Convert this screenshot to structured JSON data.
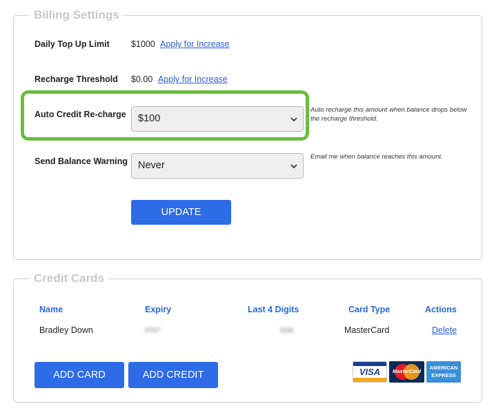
{
  "billing": {
    "legend": "Billing Settings",
    "daily_limit": {
      "label": "Daily Top Up Limit",
      "value": "$1000",
      "link": "Apply for Increase"
    },
    "recharge_threshold": {
      "label": "Recharge Threshold",
      "value": "$0.00",
      "link": "Apply for Increase"
    },
    "auto_recharge": {
      "label": "Auto Credit Re-charge",
      "selected": "$100",
      "hint_line1": "Auto recharge this amount when balance drops below",
      "hint_line2": "the recharge threshold."
    },
    "balance_warning": {
      "label": "Send Balance Warning",
      "selected": "Never",
      "hint": "Email me when balance reaches this amount."
    },
    "update_button": "UPDATE"
  },
  "credit_cards": {
    "legend": "Credit Cards",
    "columns": [
      "Name",
      "Expiry",
      "Last 4 Digits",
      "Card Type",
      "Actions"
    ],
    "rows": [
      {
        "name": "Bradley Down",
        "expiry": "07/27",
        "last4": "3106",
        "card_type": "MasterCard",
        "action": "Delete"
      }
    ],
    "add_card_button": "ADD CARD",
    "add_credit_button": "ADD CREDIT",
    "logos": {
      "visa": "VISA",
      "mastercard": "MasterCard",
      "amex_line1": "AMERICAN",
      "amex_line2": "EXPRESS"
    }
  },
  "colors": {
    "accent": "#2e6be6",
    "highlight": "#6cbc3f",
    "header_blue": "#2a66d9"
  }
}
